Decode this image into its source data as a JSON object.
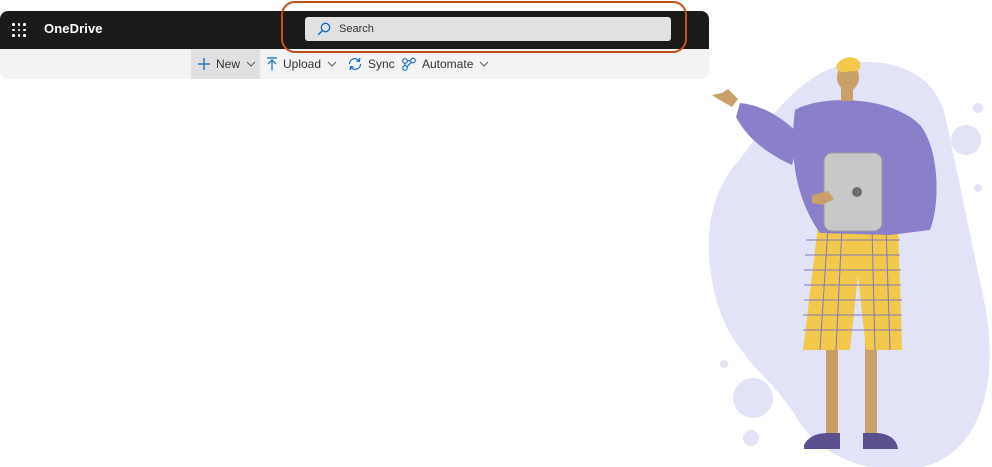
{
  "app": {
    "title": "OneDrive"
  },
  "search": {
    "placeholder": "Search"
  },
  "toolbar": {
    "new_label": "New",
    "upload_label": "Upload",
    "sync_label": "Sync",
    "automate_label": "Automate"
  },
  "icons": {
    "app_launcher": "waffle-icon",
    "search": "search-icon",
    "new": "plus-icon",
    "upload": "upload-arrow-icon",
    "sync": "sync-icon",
    "automate": "automate-icon",
    "dropdown": "chevron-down-icon"
  },
  "colors": {
    "topbar": "#1b1a19",
    "search_box": "#e1e1e1",
    "highlight": "#c1501a",
    "accent_blue": "#0f6cbd",
    "illustration_purple": "#8a80c9",
    "illustration_blob": "#e3e3f7",
    "illustration_yellow": "#f2c94c"
  }
}
